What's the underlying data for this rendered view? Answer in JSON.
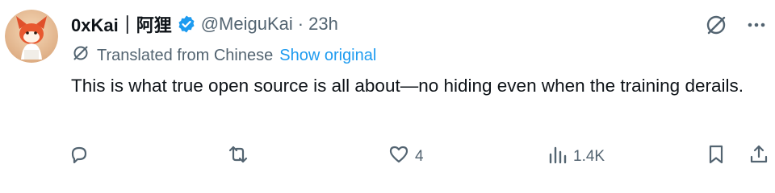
{
  "tweet": {
    "display_name": "0xKai｜阿狸",
    "handle": "@MeiguKai",
    "separator": "·",
    "time": "23h",
    "translation_label": "Translated from Chinese",
    "show_original": "Show original",
    "text": "This is what true open source is all about—no hiding even when the training derails."
  },
  "actions": {
    "likes": "4",
    "views": "1.4K"
  },
  "icons": {
    "verified": "verified-badge-icon",
    "translate": "translate-icon",
    "more": "more-icon",
    "reply": "reply-icon",
    "retweet": "retweet-icon",
    "like": "heart-icon",
    "views": "views-icon",
    "bookmark": "bookmark-icon",
    "share": "share-icon"
  },
  "colors": {
    "accent": "#1d9bf0",
    "muted": "#536471",
    "text": "#0f1419"
  }
}
